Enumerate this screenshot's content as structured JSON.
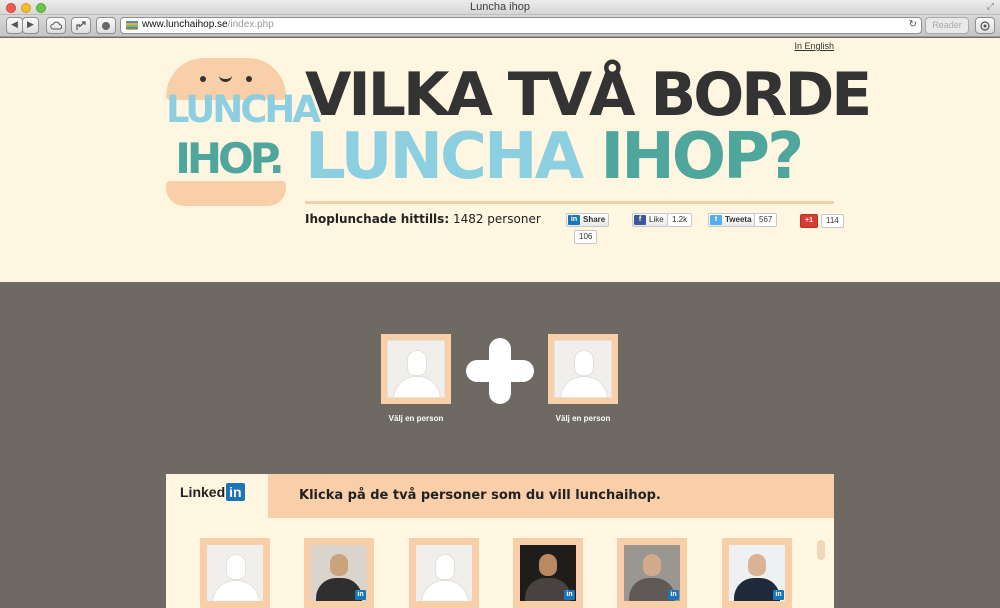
{
  "browser": {
    "window_title": "Luncha ihop",
    "url_domain": "www.lunchaihop.se",
    "url_path": "/index.php",
    "reader_label": "Reader",
    "back_glyph": "◀",
    "forward_glyph": "▶",
    "reload_glyph": "↻"
  },
  "header": {
    "lang_link": "In English",
    "logo_word_1": "LUNCHA",
    "logo_word_2": "IHOP.",
    "headline_line_1": "VILKA TVÅ BORDE",
    "headline_word_1": "LUNCHA",
    "headline_word_2": "IHOP?",
    "counter_label": "Ihoplunchade hittills:",
    "counter_value": "1482 personer",
    "colors": {
      "light_blue": "#8ccfe0",
      "teal": "#4ea69c",
      "peach": "#f9cfaa",
      "cream": "#fff6e2",
      "dark": "#333333"
    }
  },
  "social": {
    "linkedin": {
      "label": "Share",
      "count": "106",
      "icon": "linkedin-icon"
    },
    "facebook": {
      "label": "Like",
      "count": "1.2k",
      "icon": "facebook-icon"
    },
    "twitter": {
      "label": "Tweeta",
      "count": "567",
      "icon": "twitter-icon"
    },
    "googleplus": {
      "label": "+1",
      "count": "114",
      "icon": "google-plus-icon"
    }
  },
  "picker": {
    "slot_1_label": "Välj en person",
    "slot_2_label": "Välj en person",
    "plus_icon": "plus-icon"
  },
  "panel": {
    "logo_text": "Linked",
    "logo_in": "in",
    "instruction": "Klicka på de två personer som du vill lunchaihop.",
    "badge_text": "in",
    "people": [
      {
        "has_photo": false
      },
      {
        "has_photo": true
      },
      {
        "has_photo": false
      },
      {
        "has_photo": true
      },
      {
        "has_photo": true
      },
      {
        "has_photo": true
      }
    ]
  }
}
